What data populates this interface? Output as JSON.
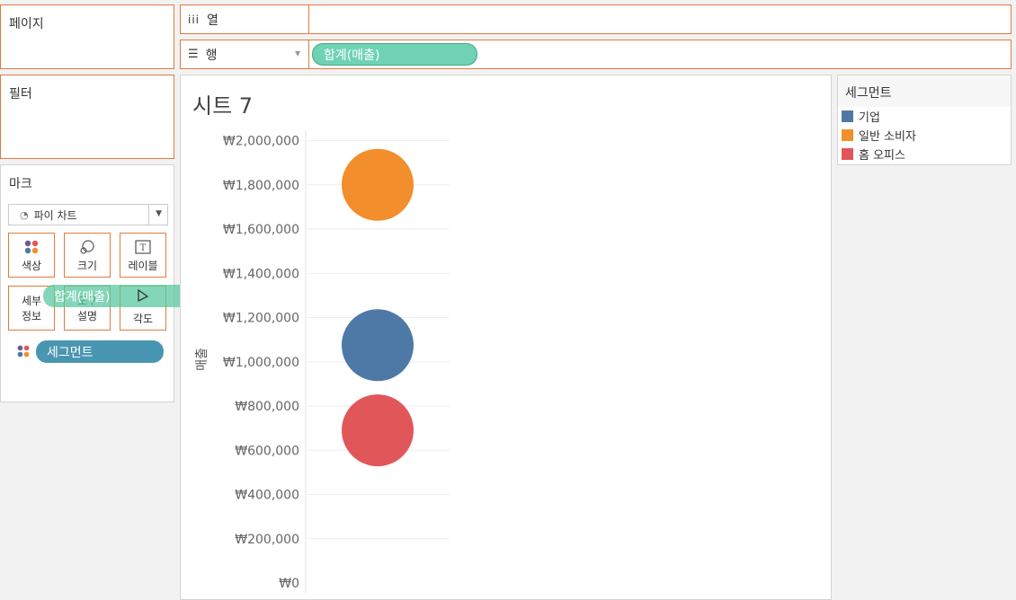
{
  "shelves": {
    "pages_title": "페이지",
    "filters_title": "필터",
    "columns_label": "열",
    "rows_label": "행",
    "rows_pill": "합계(매출)"
  },
  "marks": {
    "title": "마크",
    "mark_type": "파이 차트",
    "buttons": {
      "color": "색상",
      "size": "크기",
      "label": "레이블",
      "detail": "세부\n정보",
      "tooltip": "도구\n설명",
      "angle": "각도"
    },
    "dragging_pill": "합계(매출)",
    "segment_pill": "세그먼트"
  },
  "sheet": {
    "title": "시트 7",
    "y_axis_label": "매출"
  },
  "legend": {
    "title": "세그먼트",
    "items": [
      {
        "label": "기업",
        "color": "#4e79a7"
      },
      {
        "label": "일반 소비자",
        "color": "#f28e2b"
      },
      {
        "label": "홈 오피스",
        "color": "#e15759"
      }
    ]
  },
  "chart_data": {
    "type": "scatter",
    "ylabel": "매출",
    "ylim": [
      0,
      2000000
    ],
    "y_ticks": [
      "₩0",
      "₩200,000",
      "₩400,000",
      "₩600,000",
      "₩800,000",
      "₩1,000,000",
      "₩1,200,000",
      "₩1,400,000",
      "₩1,600,000",
      "₩1,800,000",
      "₩2,000,000"
    ],
    "y_tick_values": [
      0,
      200000,
      400000,
      600000,
      800000,
      1000000,
      1200000,
      1400000,
      1600000,
      1800000,
      2000000
    ],
    "series": [
      {
        "name": "일반 소비자",
        "values": [
          1800000
        ],
        "color": "#f28e2b"
      },
      {
        "name": "기업",
        "values": [
          1075000
        ],
        "color": "#4e79a7"
      },
      {
        "name": "홈 오피스",
        "values": [
          690000
        ],
        "color": "#e15759"
      }
    ]
  }
}
